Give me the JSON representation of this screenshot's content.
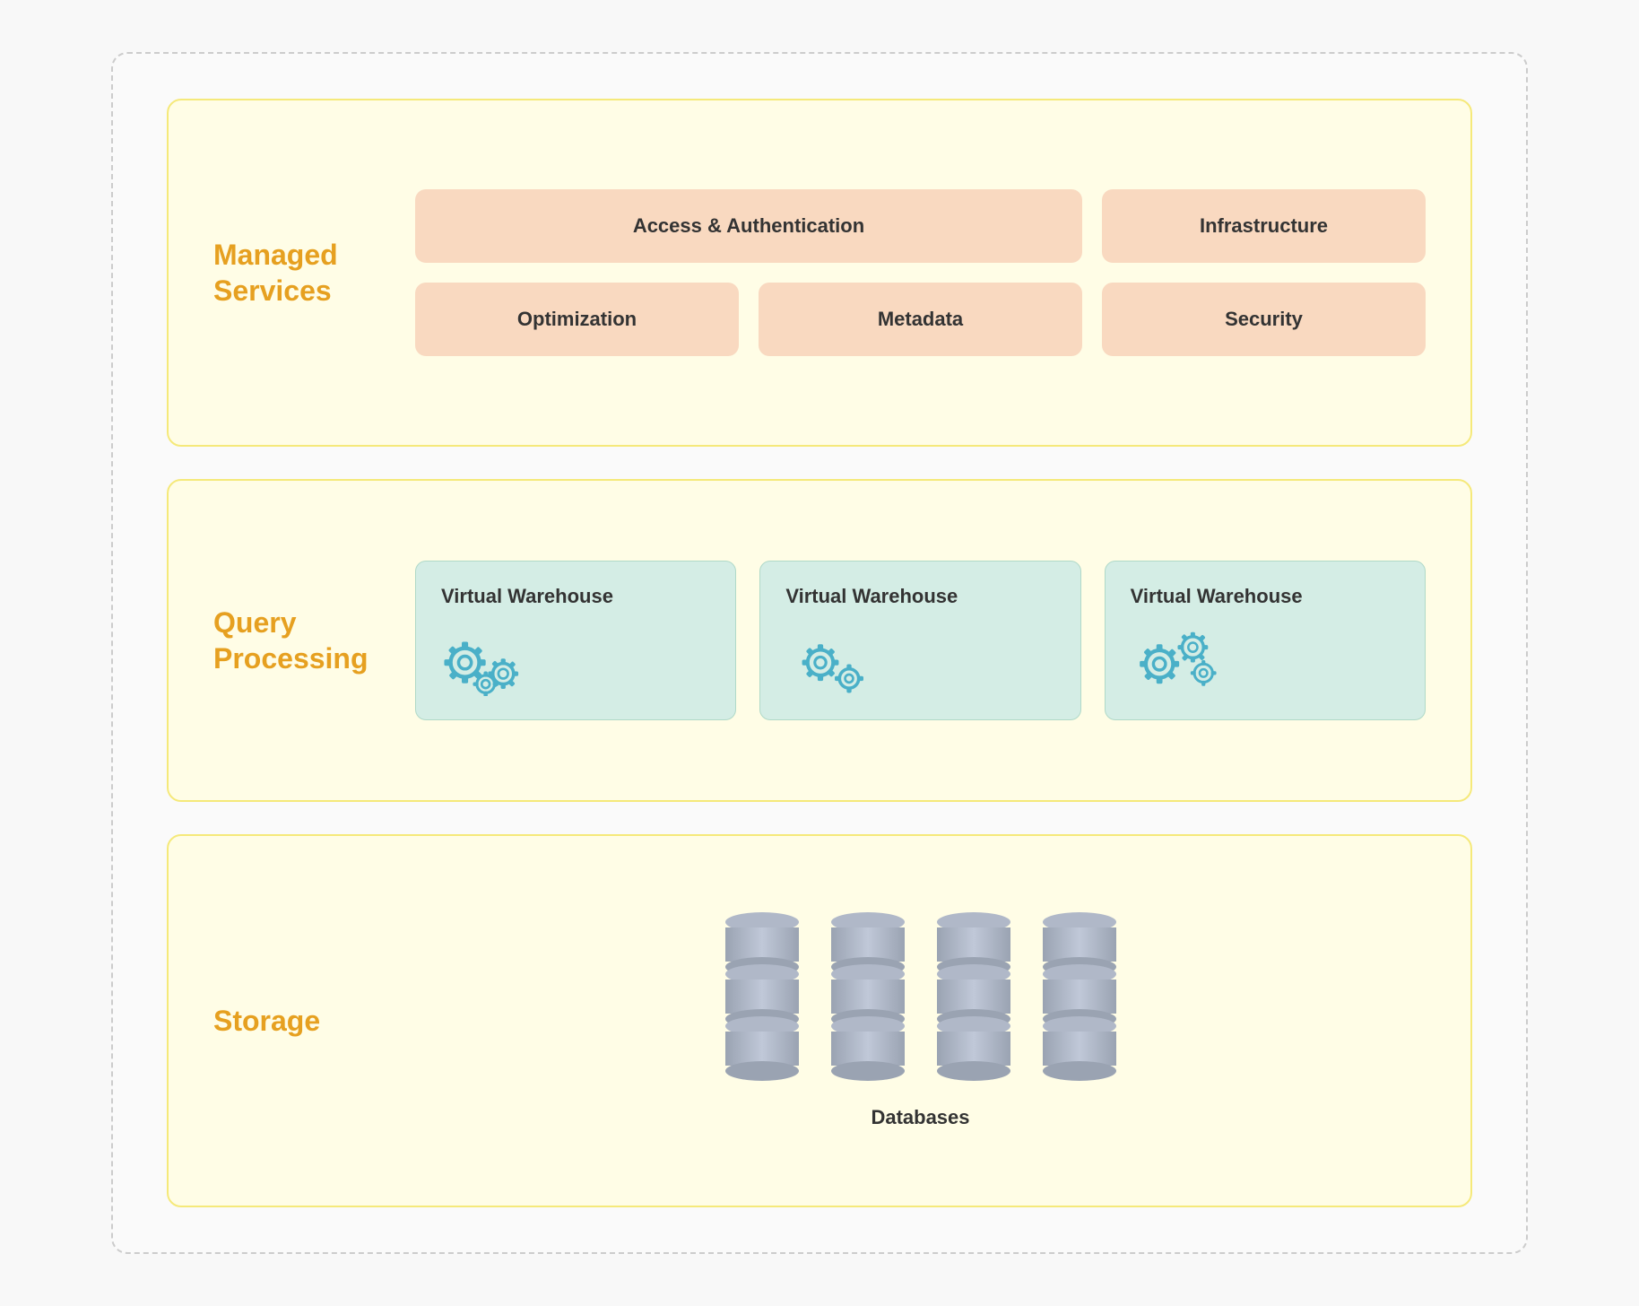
{
  "page": {
    "bg": "#f8f8f8"
  },
  "managed": {
    "title_line1": "Managed",
    "title_line2": "Services",
    "cards": [
      {
        "id": "access-auth",
        "label": "Access & Authentication",
        "wide": true
      },
      {
        "id": "infrastructure",
        "label": "Infrastructure",
        "wide": false
      },
      {
        "id": "optimization",
        "label": "Optimization",
        "wide": false
      },
      {
        "id": "metadata",
        "label": "Metadata",
        "wide": false
      },
      {
        "id": "security",
        "label": "Security",
        "wide": false
      }
    ]
  },
  "query": {
    "title_line1": "Query",
    "title_line2": "Processing",
    "warehouses": [
      {
        "id": "wh1",
        "label": "Virtual Warehouse"
      },
      {
        "id": "wh2",
        "label": "Virtual Warehouse"
      },
      {
        "id": "wh3",
        "label": "Virtual Warehouse"
      }
    ]
  },
  "storage": {
    "title": "Storage",
    "db_label": "Databases",
    "db_count": 4
  }
}
